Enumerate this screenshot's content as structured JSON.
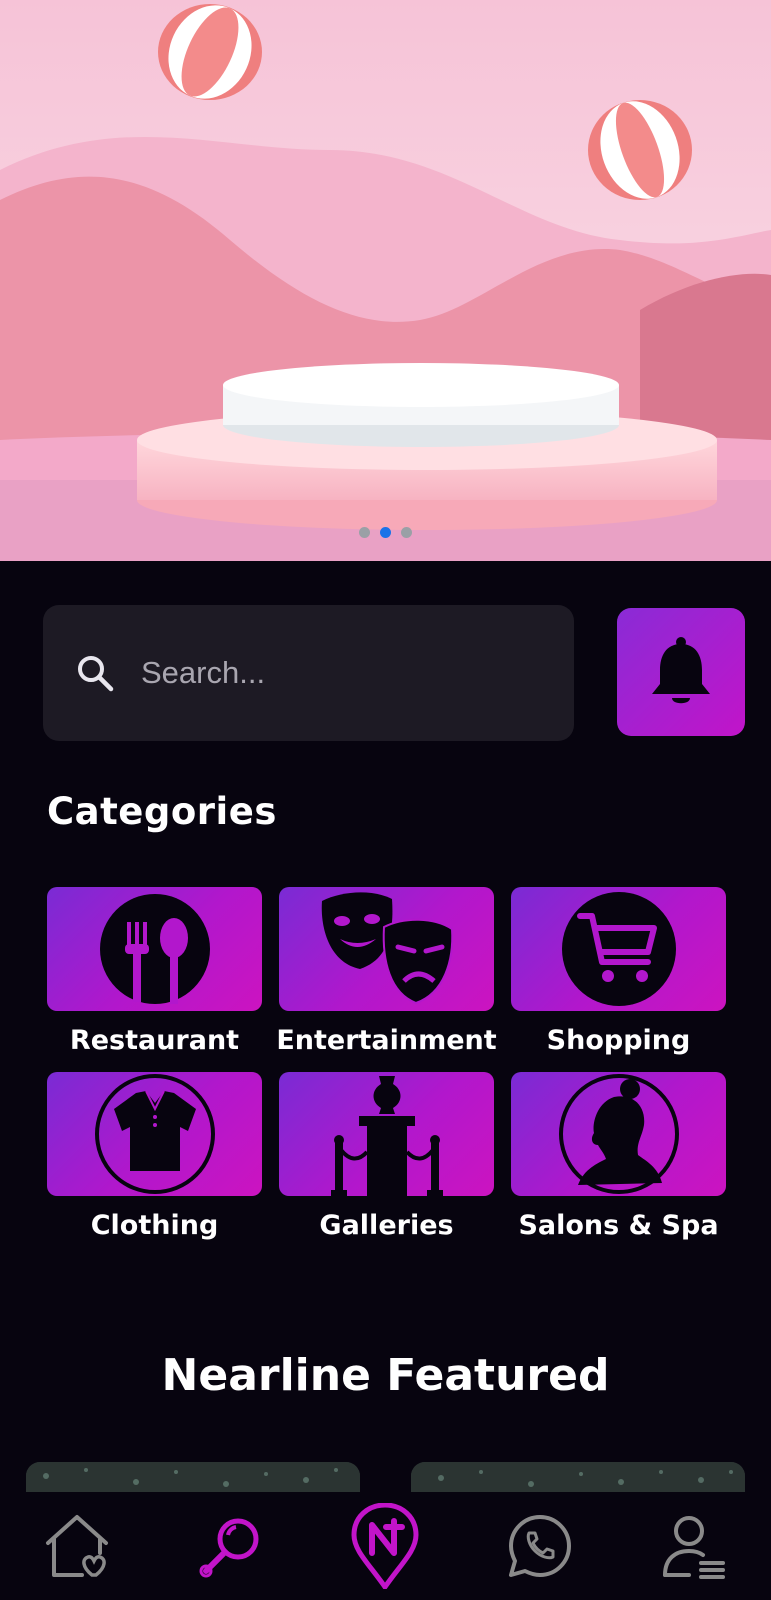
{
  "hero": {
    "carousel": {
      "count": 3,
      "active_index": 1
    }
  },
  "search": {
    "placeholder": "Search..."
  },
  "categories": {
    "title": "Categories",
    "items": [
      {
        "label": "Restaurant",
        "icon": "restaurant-icon"
      },
      {
        "label": "Entertainment",
        "icon": "theater-masks-icon"
      },
      {
        "label": "Shopping",
        "icon": "shopping-cart-icon"
      },
      {
        "label": "Clothing",
        "icon": "shirt-icon"
      },
      {
        "label": "Galleries",
        "icon": "gallery-exhibit-icon"
      },
      {
        "label": "Salons & Spa",
        "icon": "salon-woman-icon"
      }
    ]
  },
  "featured": {
    "title": "Nearline Featured"
  },
  "nav": {
    "items": [
      {
        "icon": "home-heart-icon",
        "active": false
      },
      {
        "icon": "search-icon",
        "active": true
      },
      {
        "icon": "nearline-pin-icon",
        "active": true
      },
      {
        "icon": "whatsapp-icon",
        "active": false
      },
      {
        "icon": "profile-menu-icon",
        "active": false
      }
    ]
  },
  "colors": {
    "background": "#07040f",
    "accent": "#c214c9",
    "accent_start": "#7a2bd4",
    "search_bg": "#1d1a24",
    "nav_inactive": "#8a8a8a"
  }
}
